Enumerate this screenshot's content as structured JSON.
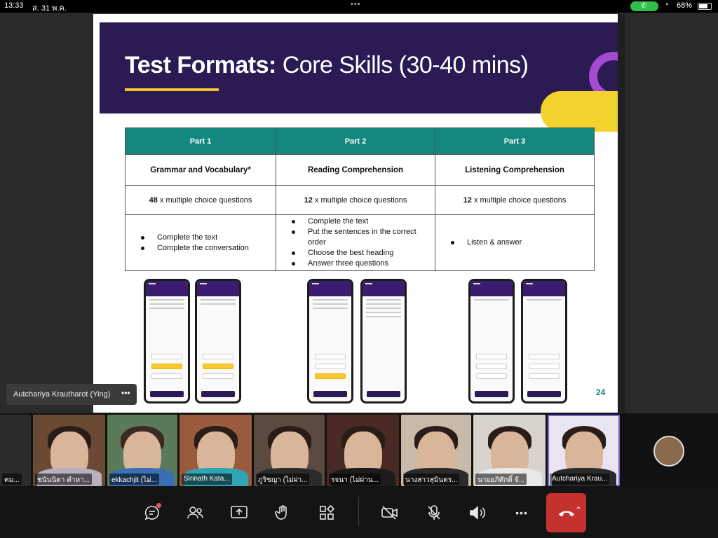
{
  "status_bar": {
    "time": "13:33",
    "date": "ส. 31 พ.ค.",
    "battery": "68%",
    "call_icon": "phone-icon",
    "wifi_icon": "wifi-icon"
  },
  "slide": {
    "title_bold": "Test Formats:",
    "title_rest": " Core Skills (30-40 mins)",
    "page_number": "24",
    "accent_colors": {
      "banner": "#2b1a53",
      "teal": "#14877f",
      "yellow": "#f2c22f",
      "purple": "#a24bd0"
    },
    "table": {
      "headers": [
        "Part 1",
        "Part 2",
        "Part 3"
      ],
      "skills": [
        "Grammar and Vocabulary*",
        "Reading Comprehension",
        "Listening Comprehension"
      ],
      "counts": [
        {
          "num": "48",
          "text": " x multiple choice questions"
        },
        {
          "num": "12",
          "text": " x multiple choice questions"
        },
        {
          "num": "12",
          "text": " x multiple choice questions"
        }
      ],
      "tasks": [
        [
          "Complete the text",
          "Complete the conversation"
        ],
        [
          "Complete the text",
          "Put the sentences in the correct order",
          "Choose the best heading",
          "Answer three questions"
        ],
        [
          "Listen & answer"
        ]
      ]
    }
  },
  "presenter_tag": {
    "name": "Autchariya Krautharot (Ying)",
    "more": "•••"
  },
  "participants": [
    {
      "name": "คม..."
    },
    {
      "name": "ชนันนิดา คำหา..."
    },
    {
      "name": "ekkachjit (ไม่..."
    },
    {
      "name": "Sirinath Kata..."
    },
    {
      "name": "ภูริชญา (ไม่ผ่า..."
    },
    {
      "name": "รจนา (ไม่ผ่าน..."
    },
    {
      "name": "นางสาวสุมินตร..."
    },
    {
      "name": "นายอภิศักดิ์ จั..."
    },
    {
      "name": "Autchariya Krau..."
    }
  ],
  "toolbar": {
    "chat_icon": "chat-icon",
    "people_icon": "people-icon",
    "share_icon": "share-screen-icon",
    "raise_hand_icon": "raise-hand-icon",
    "apps_icon": "apps-icon",
    "video_icon": "video-off-icon",
    "mic_icon": "mic-off-icon",
    "speaker_icon": "speaker-icon",
    "more": "•••",
    "hangup_icon": "hang-up-icon"
  }
}
